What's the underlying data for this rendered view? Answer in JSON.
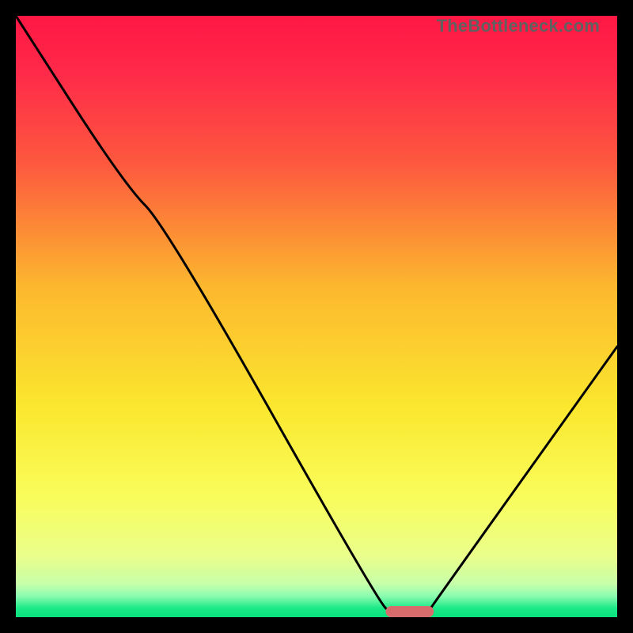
{
  "watermark": "TheBottleneck.com",
  "chart_data": {
    "type": "line",
    "title": "",
    "xlabel": "",
    "ylabel": "",
    "xlim": [
      0,
      100
    ],
    "ylim": [
      0,
      100
    ],
    "grid": false,
    "legend": null,
    "curve": {
      "name": "bottleneck-curve",
      "x": [
        0,
        18,
        25,
        60,
        63,
        68,
        70,
        100
      ],
      "values": [
        100,
        72,
        65,
        3,
        0,
        0,
        3,
        45
      ]
    },
    "optimal_marker": {
      "x_center": 65.5,
      "width": 8,
      "y": 0,
      "color": "#d86b6b"
    },
    "gradient_stops": [
      {
        "pos": 0.0,
        "color": "#ff1744"
      },
      {
        "pos": 0.1,
        "color": "#ff2b49"
      },
      {
        "pos": 0.25,
        "color": "#fd5a3e"
      },
      {
        "pos": 0.45,
        "color": "#fcb72e"
      },
      {
        "pos": 0.65,
        "color": "#fbe72e"
      },
      {
        "pos": 0.8,
        "color": "#f9fd5b"
      },
      {
        "pos": 0.9,
        "color": "#e9fe8c"
      },
      {
        "pos": 0.945,
        "color": "#c6ffa9"
      },
      {
        "pos": 0.965,
        "color": "#8bfcb0"
      },
      {
        "pos": 0.985,
        "color": "#1bea87"
      },
      {
        "pos": 1.0,
        "color": "#09e07c"
      }
    ]
  }
}
